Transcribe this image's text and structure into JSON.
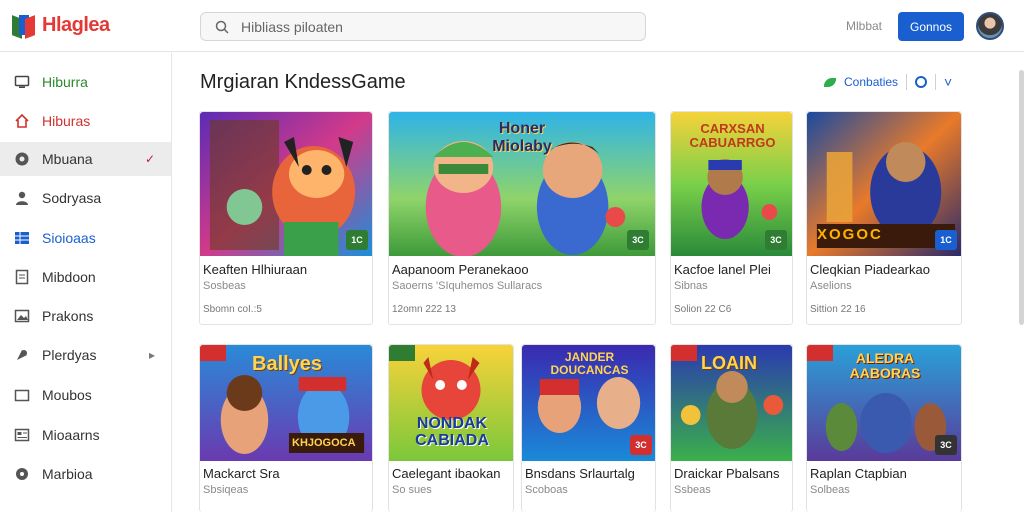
{
  "app": {
    "name": "Hlaglea"
  },
  "search": {
    "placeholder": "Hibliass piloaten"
  },
  "header": {
    "link": "Mlbbat",
    "button": "Gonnos"
  },
  "sidebar": {
    "items": [
      {
        "label": "Hiburra",
        "icon": "monitor-icon",
        "color": "#2a8a2a"
      },
      {
        "label": "Hiburas",
        "icon": "home-icon",
        "color": "#d32f2f"
      },
      {
        "label": "Mbuana",
        "icon": "gear-icon",
        "color": "#333333",
        "arrow": "✓"
      },
      {
        "label": "Sodryasa",
        "icon": "person-icon",
        "color": "#333333"
      },
      {
        "label": "Sioioaas",
        "icon": "grid-icon",
        "color": "#1a5fd0"
      },
      {
        "label": "Mibdoon",
        "icon": "document-icon",
        "color": "#333333"
      },
      {
        "label": "Prakons",
        "icon": "picture-icon",
        "color": "#333333"
      },
      {
        "label": "Plerdyas",
        "icon": "gamepad-icon",
        "color": "#333333",
        "arrow": "▸"
      },
      {
        "label": "Moubos",
        "icon": "folder-icon",
        "color": "#333333"
      },
      {
        "label": "Mioaarns",
        "icon": "list-icon",
        "color": "#333333"
      },
      {
        "label": "Marbioa",
        "icon": "circle-icon",
        "color": "#333333"
      }
    ]
  },
  "main": {
    "title": "Mrgiaran KndessGame",
    "controls": {
      "label": "Conbaties",
      "chevron": "˅"
    },
    "row1": [
      {
        "title": "Keaften Hlhiuraan",
        "sub": "Sosbeas",
        "meta": "Sbomn coI.:5",
        "badge": "1C"
      },
      {
        "title": "Aapanoom Peranekaoo",
        "sub": "Saoerns 'SIquhemos Sullaracs",
        "meta": "12omn 222 13",
        "badge": "3C"
      },
      {
        "title": "Kacfoe lanel Plei",
        "sub": "Sibnas",
        "meta": "Solion 22 C6",
        "badge": "3C"
      },
      {
        "title": "Cleqkian Piadearkao",
        "sub": "Aselions",
        "meta": "Sittion 22 16",
        "badge": "1C"
      }
    ],
    "row2": [
      {
        "title": "Mackarct Sra",
        "sub": "Sbsiqeas",
        "badge": ""
      },
      {
        "title": "Caelegant ibaokan",
        "sub": "So sues",
        "badge": ""
      },
      {
        "title": "Bnsdans Srlaurtalg",
        "sub": "Scoboas",
        "badge": "3C"
      },
      {
        "title": "Draickar Pbalsans",
        "sub": "Ssbeas",
        "badge": ""
      },
      {
        "title": "Raplan Ctapbian",
        "sub": "Solbeas",
        "badge": "3C"
      }
    ]
  },
  "thumb_text": {
    "r1c2": "Honer\nMiolaby",
    "r1c3": "CARXSAN\nCABUARRGO",
    "r1c4": "XOGOC",
    "r2c1": "Ballyes",
    "r2c1b": "KHJOGOCA",
    "r2c2": "NONDAK\nCABIADA",
    "r2c3": "JANDER\nDOUCANCAS",
    "r2c4": "LOAIN",
    "r2c5": "ALEDRA\nAABORAS"
  }
}
